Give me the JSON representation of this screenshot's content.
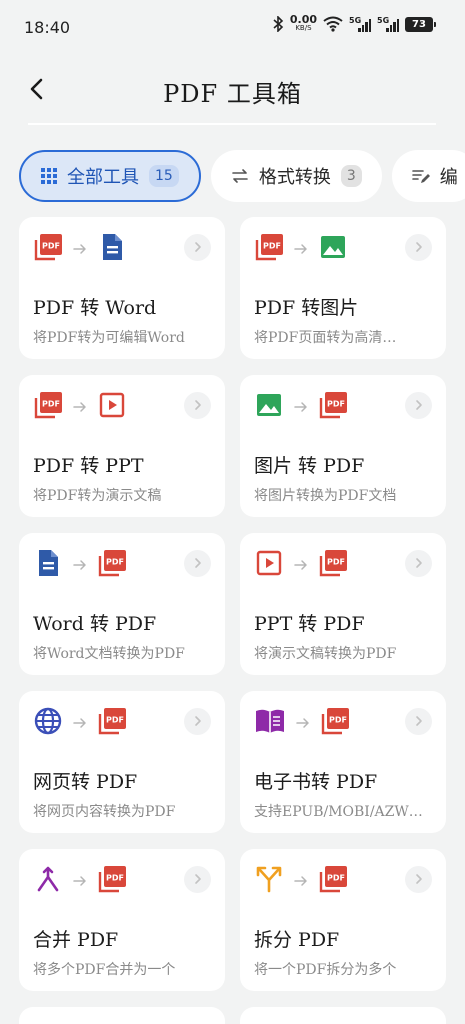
{
  "status_bar": {
    "time": "18:40",
    "net_speed": "0.00",
    "net_unit": "KB/S",
    "sim1": "5G",
    "sim2": "5G",
    "battery": "73"
  },
  "header": {
    "title": "PDF 工具箱"
  },
  "tabs": [
    {
      "label": "全部工具",
      "count": "15",
      "icon": "grid-icon"
    },
    {
      "label": "格式转换",
      "count": "3",
      "icon": "swap-arrows-icon"
    },
    {
      "label": "编",
      "icon": "edit-lines-icon"
    }
  ],
  "tools": [
    {
      "title": "PDF 转 Word",
      "desc": "将PDF转为可编辑Word",
      "from_icon": "pdf-icon",
      "to_icon": "word-doc-icon"
    },
    {
      "title": "PDF 转图片",
      "desc": "将PDF页面转为高清…",
      "from_icon": "pdf-icon",
      "to_icon": "image-icon"
    },
    {
      "title": "PDF 转 PPT",
      "desc": "将PDF转为演示文稿",
      "from_icon": "pdf-icon",
      "to_icon": "ppt-icon"
    },
    {
      "title": "图片 转 PDF",
      "desc": "将图片转换为PDF文档",
      "from_icon": "image-icon",
      "to_icon": "pdf-icon"
    },
    {
      "title": "Word 转 PDF",
      "desc": "将Word文档转换为PDF",
      "from_icon": "word-doc-icon",
      "to_icon": "pdf-icon"
    },
    {
      "title": "PPT 转 PDF",
      "desc": "将演示文稿转换为PDF",
      "from_icon": "ppt-icon",
      "to_icon": "pdf-icon"
    },
    {
      "title": "网页转 PDF",
      "desc": "将网页内容转换为PDF",
      "from_icon": "globe-icon",
      "to_icon": "pdf-icon"
    },
    {
      "title": "电子书转 PDF",
      "desc": "支持EPUB/MOBI/AZW…",
      "from_icon": "ebook-icon",
      "to_icon": "pdf-icon"
    },
    {
      "title": "合并 PDF",
      "desc": "将多个PDF合并为一个",
      "from_icon": "merge-icon",
      "to_icon": "pdf-icon"
    },
    {
      "title": "拆分 PDF",
      "desc": "将一个PDF拆分为多个",
      "from_icon": "split-icon",
      "to_icon": "pdf-icon"
    }
  ],
  "colors": {
    "accent": "#2b6bd6",
    "pdf_red": "#d9473a",
    "word_blue": "#2f5aa8",
    "image_green": "#2ea55a",
    "globe_indigo": "#3b4fb8",
    "ebook_purple": "#8e2aa8",
    "split_orange": "#f0a020"
  }
}
